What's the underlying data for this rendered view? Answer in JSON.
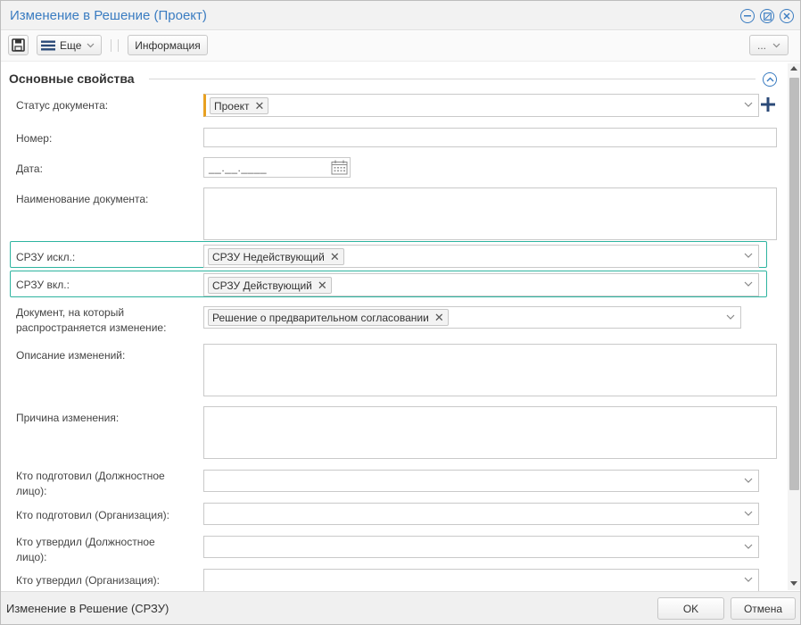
{
  "window": {
    "title": "Изменение в Решение (Проект)"
  },
  "toolbar": {
    "more_label": "Еще",
    "info_label": "Информация",
    "overflow_label": "..."
  },
  "section": {
    "title": "Основные свойства"
  },
  "fields": {
    "status": {
      "label": "Статус документа:",
      "tag": "Проект"
    },
    "number": {
      "label": "Номер:",
      "value": ""
    },
    "date": {
      "label": "Дата:",
      "value": "__.__.____"
    },
    "name": {
      "label": "Наименование документа:",
      "value": ""
    },
    "srzu_excl": {
      "label": "СРЗУ искл.:",
      "tag": "СРЗУ Недействующий"
    },
    "srzu_incl": {
      "label": "СРЗУ вкл.:",
      "tag": "СРЗУ Действующий"
    },
    "target_doc": {
      "label_line1": "Документ, на который",
      "label_line2": "распространяется изменение:",
      "tag": "Решение о предварительном согласовании"
    },
    "change_desc": {
      "label": "Описание изменений:",
      "value": ""
    },
    "change_reason": {
      "label": "Причина изменения:",
      "value": ""
    },
    "prepared_by_person": {
      "label_line1": "Кто подготовил (Должностное",
      "label_line2": "лицо):",
      "value": ""
    },
    "prepared_by_org": {
      "label": "Кто подготовил (Организация):",
      "value": ""
    },
    "approved_by_person": {
      "label_line1": "Кто утвердил (Должностное",
      "label_line2": "лицо):",
      "value": ""
    },
    "approved_by_org": {
      "label": "Кто утвердил (Организация):",
      "value": ""
    }
  },
  "footer": {
    "status_text": "Изменение в Решение (СРЗУ)",
    "ok_label": "OK",
    "cancel_label": "Отмена"
  },
  "colors": {
    "accent": "#3a7cc1",
    "highlight": "#2eb4a0",
    "required_marker": "#e8a020"
  }
}
